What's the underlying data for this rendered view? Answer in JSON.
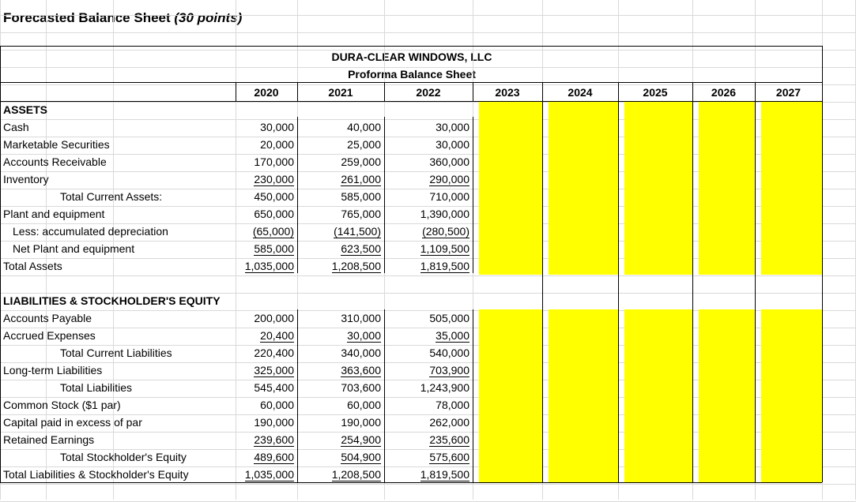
{
  "sheet": {
    "title_main": "Forecasted Balance Sheet ",
    "title_points": "(30 points)",
    "company": "DURA-CLEAR WINDOWS, LLC",
    "subtitle": "Proforma Balance Sheet",
    "years": [
      "2020",
      "2021",
      "2022",
      "2023",
      "2024",
      "2025",
      "2026",
      "2027"
    ],
    "highlight_color": "#ffff00",
    "assets_header": "ASSETS",
    "liab_header": "LIABILITIES & STOCKHOLDER'S EQUITY",
    "assets": [
      {
        "label": "Cash",
        "indent": 0,
        "values": [
          "30,000",
          "40,000",
          "30,000"
        ],
        "underline": false
      },
      {
        "label": "Marketable Securities",
        "indent": 0,
        "values": [
          "20,000",
          "25,000",
          "30,000"
        ],
        "underline": false
      },
      {
        "label": "Accounts Receivable",
        "indent": 0,
        "values": [
          "170,000",
          "259,000",
          "360,000"
        ],
        "underline": false
      },
      {
        "label": "Inventory",
        "indent": 0,
        "values": [
          "230,000",
          "261,000",
          "290,000"
        ],
        "underline": true
      },
      {
        "label": "Total Current Assets:",
        "indent": 2,
        "values": [
          "450,000",
          "585,000",
          "710,000"
        ],
        "underline": false
      },
      {
        "label": "Plant and equipment",
        "indent": 0,
        "values": [
          "650,000",
          "765,000",
          "1,390,000"
        ],
        "underline": false
      },
      {
        "label": "Less:  accumulated depreciation",
        "indent": 1,
        "values": [
          "(65,000)",
          "(141,500)",
          "(280,500)"
        ],
        "underline": true
      },
      {
        "label": "Net Plant and equipment",
        "indent": 1,
        "values": [
          "585,000",
          "623,500",
          "1,109,500"
        ],
        "underline": true
      },
      {
        "label": "Total Assets",
        "indent": 0,
        "values": [
          "1,035,000",
          "1,208,500",
          "1,819,500"
        ],
        "underline": true
      }
    ],
    "liabilities": [
      {
        "label": "Accounts Payable",
        "indent": 0,
        "values": [
          "200,000",
          "310,000",
          "505,000"
        ],
        "underline": false
      },
      {
        "label": "Accrued Expenses",
        "indent": 0,
        "values": [
          "20,400",
          "30,000",
          "35,000"
        ],
        "underline": true
      },
      {
        "label": "Total Current Liabilities",
        "indent": 2,
        "values": [
          "220,400",
          "340,000",
          "540,000"
        ],
        "underline": false
      },
      {
        "label": "Long-term Liabilities",
        "indent": 0,
        "values": [
          "325,000",
          "363,600",
          "703,900"
        ],
        "underline": true
      },
      {
        "label": "Total Liabilities",
        "indent": 2,
        "values": [
          "545,400",
          "703,600",
          "1,243,900"
        ],
        "underline": false
      },
      {
        "label": "Common Stock ($1 par)",
        "indent": 0,
        "values": [
          "60,000",
          "60,000",
          "78,000"
        ],
        "underline": false
      },
      {
        "label": "Capital paid in excess of par",
        "indent": 0,
        "values": [
          "190,000",
          "190,000",
          "262,000"
        ],
        "underline": false
      },
      {
        "label": "Retained Earnings",
        "indent": 0,
        "values": [
          "239,600",
          "254,900",
          "235,600"
        ],
        "underline": true
      },
      {
        "label": "Total Stockholder's Equity",
        "indent": 2,
        "values": [
          "489,600",
          "504,900",
          "575,600"
        ],
        "underline": true
      },
      {
        "label": "Total Liabilities & Stockholder's Equity",
        "indent": 0,
        "values": [
          "1,035,000",
          "1,208,500",
          "1,819,500"
        ],
        "underline": true
      }
    ]
  }
}
